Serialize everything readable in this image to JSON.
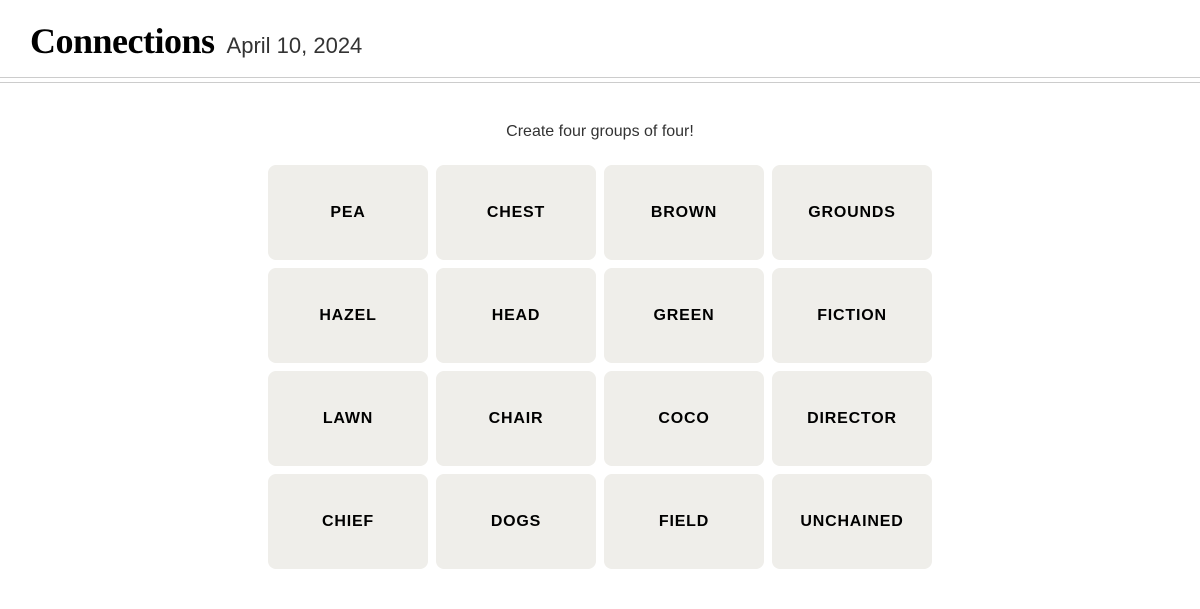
{
  "header": {
    "title": "Connections",
    "date": "April 10, 2024"
  },
  "subtitle": "Create four groups of four!",
  "grid": {
    "tiles": [
      {
        "id": "pea",
        "label": "PEA"
      },
      {
        "id": "chest",
        "label": "CHEST"
      },
      {
        "id": "brown",
        "label": "BROWN"
      },
      {
        "id": "grounds",
        "label": "GROUNDS"
      },
      {
        "id": "hazel",
        "label": "HAZEL"
      },
      {
        "id": "head",
        "label": "HEAD"
      },
      {
        "id": "green",
        "label": "GREEN"
      },
      {
        "id": "fiction",
        "label": "FICTION"
      },
      {
        "id": "lawn",
        "label": "LAWN"
      },
      {
        "id": "chair",
        "label": "CHAIR"
      },
      {
        "id": "coco",
        "label": "COCO"
      },
      {
        "id": "director",
        "label": "DIRECTOR"
      },
      {
        "id": "chief",
        "label": "CHIEF"
      },
      {
        "id": "dogs",
        "label": "DOGS"
      },
      {
        "id": "field",
        "label": "FIELD"
      },
      {
        "id": "unchained",
        "label": "UNCHAINED"
      }
    ]
  }
}
